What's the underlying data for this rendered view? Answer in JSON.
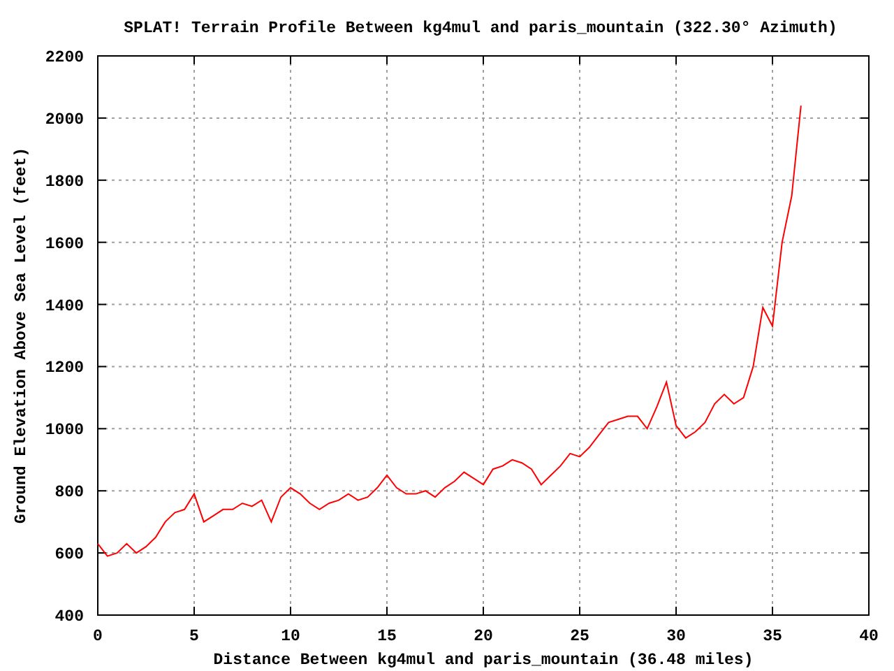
{
  "chart_data": {
    "type": "line",
    "title": "SPLAT! Terrain Profile Between kg4mul and paris_mountain (322.30° Azimuth)",
    "xlabel": "Distance Between kg4mul and paris_mountain (36.48 miles)",
    "ylabel": "Ground Elevation Above Sea Level (feet)",
    "x": [
      0,
      0.5,
      1,
      1.5,
      2,
      2.5,
      3,
      3.5,
      4,
      4.5,
      5,
      5.5,
      6,
      6.5,
      7,
      7.5,
      8,
      8.5,
      9,
      9.5,
      10,
      10.5,
      11,
      11.5,
      12,
      12.5,
      13,
      13.5,
      14,
      14.5,
      15,
      15.5,
      16,
      16.5,
      17,
      17.5,
      18,
      18.5,
      19,
      19.5,
      20,
      20.5,
      21,
      21.5,
      22,
      22.5,
      23,
      23.5,
      24,
      24.5,
      25,
      25.5,
      26,
      26.5,
      27,
      27.5,
      28,
      28.5,
      29,
      29.5,
      30,
      30.5,
      31,
      31.5,
      32,
      32.5,
      33,
      33.5,
      34,
      34.5,
      35,
      35.5,
      36,
      36.48
    ],
    "series": [
      {
        "color": "#ff0000",
        "values": [
          630,
          590,
          600,
          630,
          600,
          620,
          650,
          700,
          730,
          740,
          790,
          700,
          720,
          740,
          740,
          760,
          750,
          770,
          700,
          780,
          810,
          790,
          760,
          740,
          760,
          770,
          790,
          770,
          780,
          810,
          850,
          810,
          790,
          790,
          800,
          780,
          810,
          830,
          860,
          840,
          820,
          870,
          880,
          900,
          890,
          870,
          820,
          850,
          880,
          920,
          910,
          940,
          980,
          1020,
          1030,
          1040,
          1040,
          1000,
          1070,
          1150,
          1010,
          970,
          990,
          1020,
          1080,
          1110,
          1080,
          1100,
          1200,
          1390,
          1330,
          1600,
          1750,
          2040
        ]
      }
    ],
    "grid": true,
    "xlim": [
      0,
      40
    ],
    "ylim": [
      400,
      2200
    ],
    "xticks": [
      0,
      5,
      10,
      15,
      20,
      25,
      30,
      35,
      40
    ],
    "yticks": [
      400,
      600,
      800,
      1000,
      1200,
      1400,
      1600,
      1800,
      2000,
      2200
    ]
  }
}
